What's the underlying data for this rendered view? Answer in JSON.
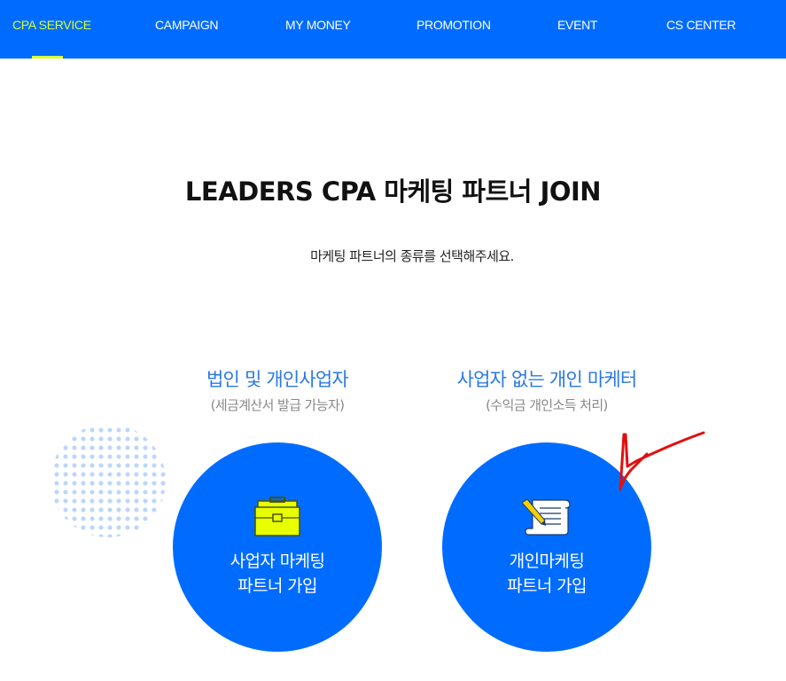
{
  "nav": {
    "items": [
      {
        "label": "CPA SERVICE",
        "active": true
      },
      {
        "label": "CAMPAIGN"
      },
      {
        "label": "MY MONEY"
      },
      {
        "label": "PROMOTION"
      },
      {
        "label": "EVENT"
      },
      {
        "label": "CS CENTER"
      }
    ],
    "colors": {
      "background": "#006cff",
      "active": "#d6ff33",
      "text": "#ffffff"
    }
  },
  "hero": {
    "title_prefix": "LEADERS CPA 마케팅 파트너",
    "title_bold": "JOIN",
    "subtitle": "마케팅 파트너의 종류를 선택해주세요."
  },
  "options": [
    {
      "heading": "법인 및 개인사업자",
      "note": "(세금계산서 발급 가능자)",
      "button_line1": "사업자 마케팅",
      "button_line2": "파트너 가입",
      "icon": "briefcase-icon"
    },
    {
      "heading": "사업자 없는 개인 마케터",
      "note": "(수익금 개인소득 처리)",
      "button_line1": "개인마케팅",
      "button_line2": "파트너 가입",
      "icon": "scroll-pencil-icon"
    }
  ],
  "colors": {
    "accent": "#006cff",
    "heading_blue": "#2a78e4",
    "annotation": "#e01010"
  }
}
